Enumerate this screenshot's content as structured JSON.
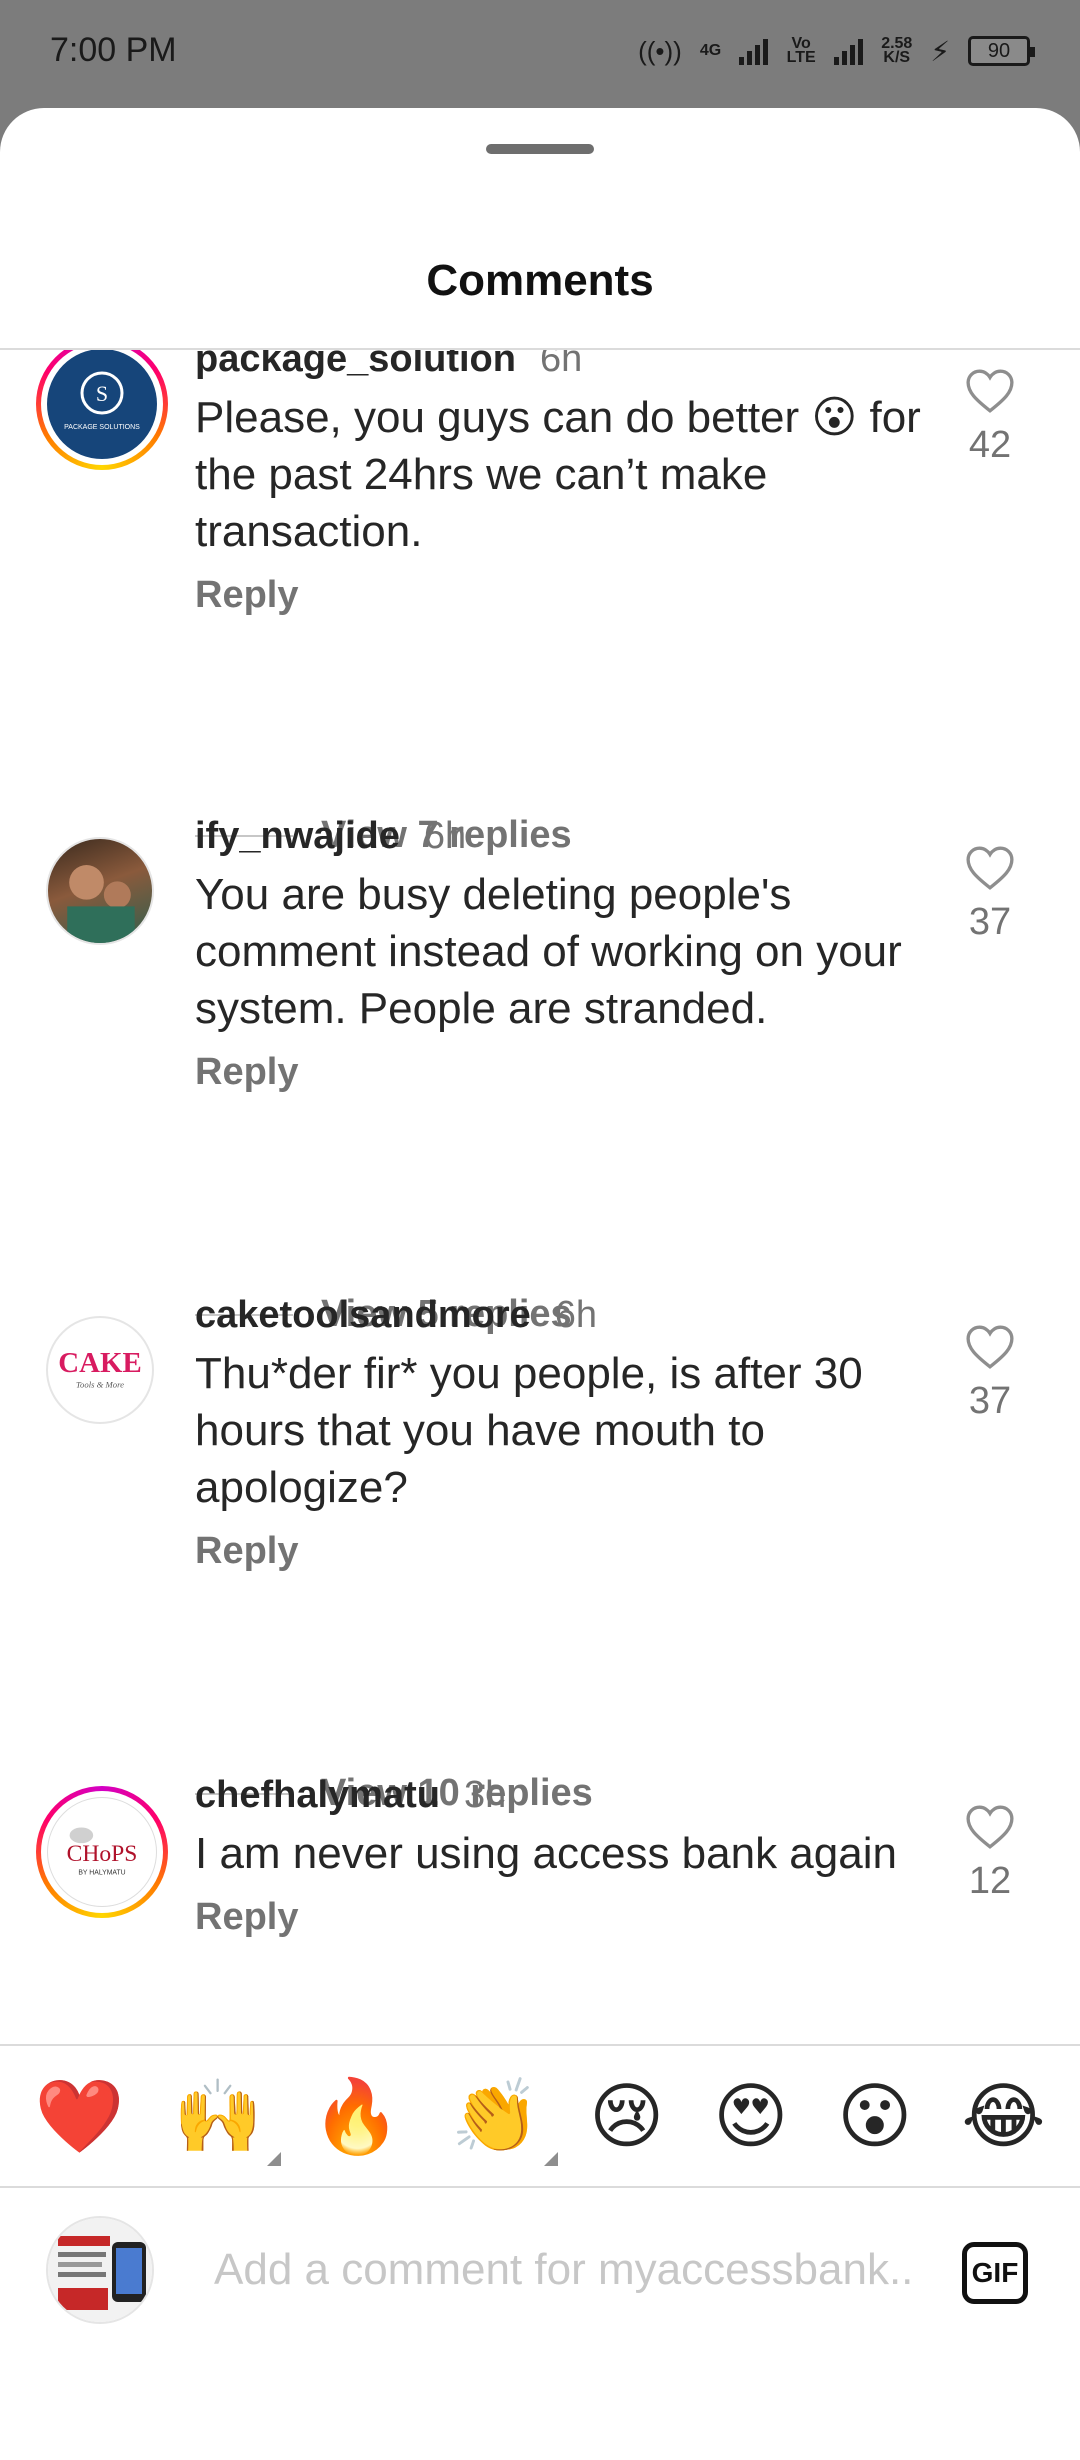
{
  "status_bar": {
    "time": "7:00 PM",
    "network": "4G",
    "volte": "Vo LTE",
    "speed": "2.58",
    "speed_unit": "K/S",
    "battery": "90"
  },
  "sheet": {
    "title": "Comments"
  },
  "comments": [
    {
      "username": "package_solution",
      "time": "6h",
      "text": "Please, you guys can do better 😮 for the past 24hrs we can’t make transaction.",
      "reply_label": "Reply",
      "likes": "42",
      "view_replies": "View 7 replies",
      "avatar_text": "PACKAGE SOLUTIONS"
    },
    {
      "username": "ify_nwajide",
      "time": "6h",
      "text": "You are busy deleting people's comment instead of working on your system. People are stranded.",
      "reply_label": "Reply",
      "likes": "37",
      "view_replies": "View 5 replies"
    },
    {
      "username": "caketoolsandmore",
      "time": "6h",
      "text": "Thu*der fir* you people, is after 30 hours that you have mouth to apologize?",
      "reply_label": "Reply",
      "likes": "37",
      "view_replies": "View 10 replies",
      "avatar_text": "CAKE",
      "avatar_subtext": "Tools & More"
    },
    {
      "username": "chefhalymatu",
      "time": "3h",
      "text": "I am never using access bank again",
      "reply_label": "Reply",
      "likes": "12",
      "avatar_text": "CHoPS",
      "avatar_subtext": "BY HALYMATU"
    }
  ],
  "emoji_bar": [
    "❤️",
    "🙌",
    "🔥",
    "👏",
    "😢",
    "😍",
    "😮",
    "😂"
  ],
  "input": {
    "placeholder": "Add a comment for myaccessbank...",
    "gif_label": "GIF"
  },
  "colors": {
    "accent_gradient": [
      "#d300c5",
      "#ff0069",
      "#ff7a00",
      "#ffd600"
    ],
    "muted_text": "#737373",
    "heart_red": "#e0202a"
  },
  "icons": {
    "like": "heart-outline-icon",
    "nav_menu": "menu-icon",
    "nav_home": "home-circle-icon",
    "nav_back": "back-icon"
  }
}
